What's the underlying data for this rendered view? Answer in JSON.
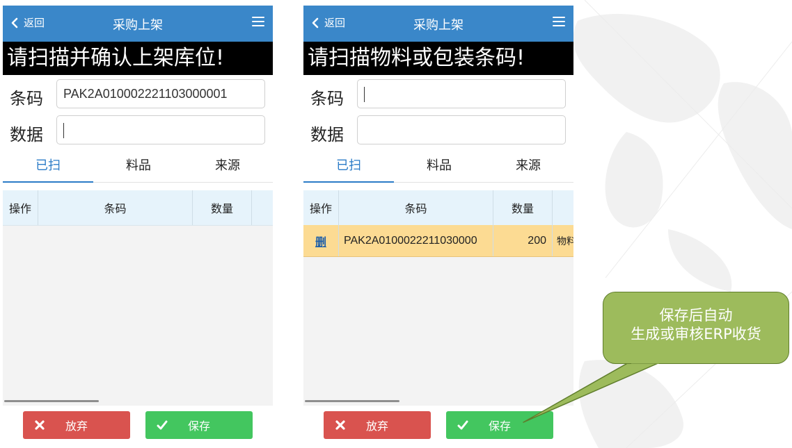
{
  "left": {
    "nav": {
      "back_label": "返回",
      "title": "采购上架"
    },
    "banner": "请扫描并确认上架库位!",
    "barcode": {
      "label": "条码",
      "value": "PAK2A010002221103000001"
    },
    "data_field": {
      "label": "数据",
      "value": ""
    },
    "tabs": [
      "已扫",
      "料品",
      "来源"
    ],
    "active_tab": "已扫",
    "table": {
      "headers": [
        "操作",
        "条码",
        "数量"
      ],
      "rows": []
    },
    "buttons": {
      "abandon": "放弃",
      "save": "保存"
    }
  },
  "right": {
    "nav": {
      "back_label": "返回",
      "title": "采购上架"
    },
    "banner": "请扫描物料或包装条码!",
    "barcode": {
      "label": "条码",
      "value": ""
    },
    "data_field": {
      "label": "数据",
      "value": ""
    },
    "tabs": [
      "已扫",
      "料品",
      "来源"
    ],
    "active_tab": "已扫",
    "table": {
      "headers": [
        "操作",
        "条码",
        "数量"
      ],
      "rows": [
        {
          "action": "删",
          "barcode": "PAK2A0100022211030000",
          "qty": "200",
          "extra": "物料"
        }
      ]
    },
    "buttons": {
      "abandon": "放弃",
      "save": "保存"
    }
  },
  "callout": {
    "line1": "保存后自动",
    "line2": "生成或审核ERP收货"
  },
  "colors": {
    "nav_bg": "#3a87c9",
    "banner_bg": "#000000",
    "tab_active": "#2a7bc7",
    "header_row": "#e6f3fb",
    "selected_row": "#fcdb93",
    "abandon_button": "#d9534f",
    "save_button": "#43c65f",
    "callout_bg": "#9dbb5c"
  },
  "icons": {
    "back": "chevron-left-icon",
    "menu": "hamburger-menu-icon",
    "abandon": "close-icon",
    "save": "check-icon"
  }
}
